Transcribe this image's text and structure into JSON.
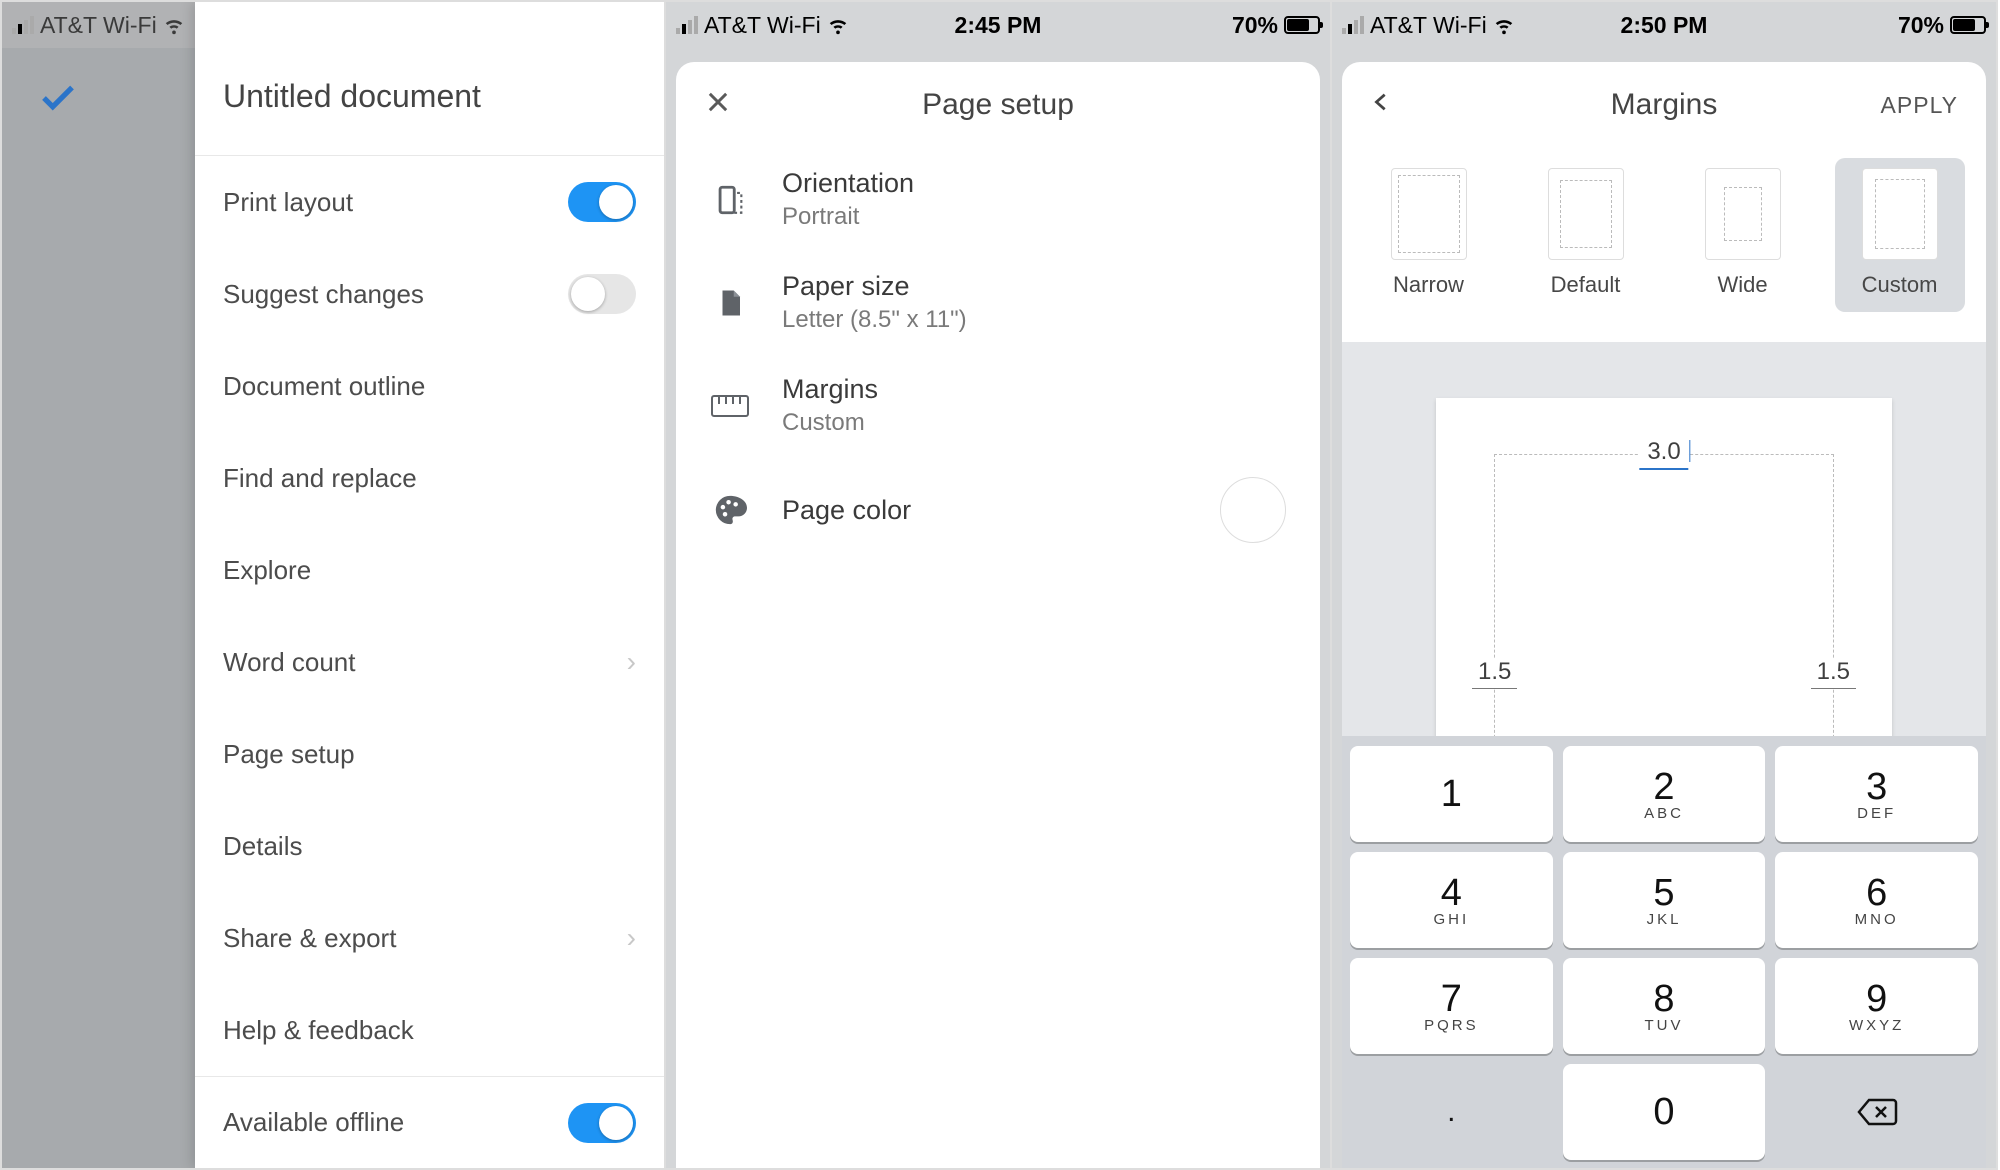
{
  "statusbar": {
    "carrier": "AT&T Wi-Fi",
    "time_a": "2:45 PM",
    "time_b": "2:45 PM",
    "time_c": "2:50 PM",
    "battery_pct": "70%"
  },
  "screen1": {
    "title": "Untitled document",
    "items": {
      "print_layout": "Print layout",
      "suggest_changes": "Suggest changes",
      "doc_outline": "Document outline",
      "find_replace": "Find and replace",
      "explore": "Explore",
      "word_count": "Word count",
      "page_setup": "Page setup",
      "details": "Details",
      "share_export": "Share & export",
      "help_feedback": "Help & feedback",
      "available_offline": "Available offline"
    },
    "toggles": {
      "print_layout": true,
      "suggest_changes": false,
      "available_offline": true
    }
  },
  "screen2": {
    "title": "Page setup",
    "orientation_label": "Orientation",
    "orientation_value": "Portrait",
    "paper_label": "Paper size",
    "paper_value": "Letter (8.5\" x 11\")",
    "margins_label": "Margins",
    "margins_value": "Custom",
    "page_color_label": "Page color"
  },
  "screen3": {
    "title": "Margins",
    "apply": "APPLY",
    "presets": {
      "narrow": "Narrow",
      "default": "Default",
      "wide": "Wide",
      "custom": "Custom"
    },
    "selected_preset": "custom",
    "margins": {
      "top": "3.0",
      "left": "1.5",
      "right": "1.5"
    }
  },
  "keypad": {
    "k1": "1",
    "k2": "2",
    "k3": "3",
    "k4": "4",
    "k5": "5",
    "k6": "6",
    "k7": "7",
    "k8": "8",
    "k9": "9",
    "k0": "0",
    "s2": "ABC",
    "s3": "DEF",
    "s4": "GHI",
    "s5": "JKL",
    "s6": "MNO",
    "s7": "PQRS",
    "s8": "TUV",
    "s9": "WXYZ",
    "dot": "."
  }
}
